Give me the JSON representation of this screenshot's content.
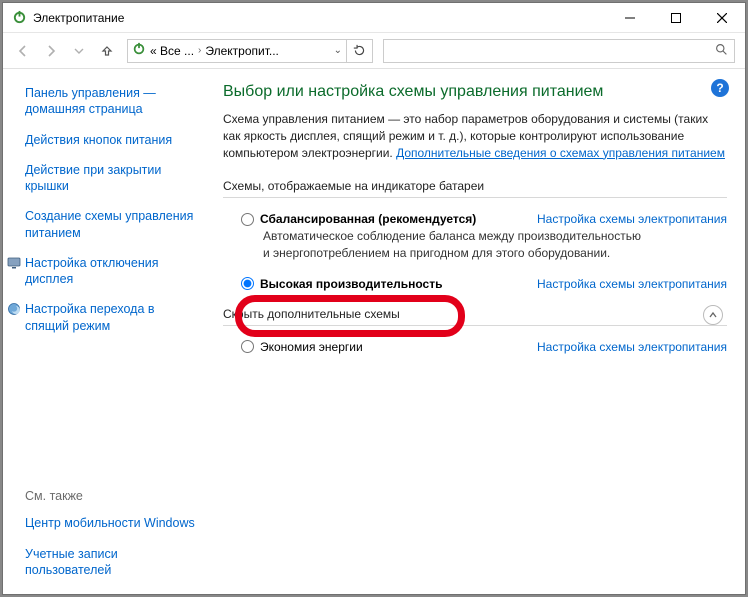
{
  "window": {
    "title": "Электропитание"
  },
  "address": {
    "crumb1": "« Все ...",
    "crumb2": "Электропит..."
  },
  "sidebar": {
    "home": "Панель управления — домашняя страница",
    "links": [
      "Действия кнопок питания",
      "Действие при закрытии крышки",
      "Создание схемы управления питанием"
    ],
    "iconLinks": [
      "Настройка отключения дисплея",
      "Настройка перехода в спящий режим"
    ],
    "seeAlsoHeader": "См. также",
    "seeAlso": [
      "Центр мобильности Windows",
      "Учетные записи пользователей"
    ]
  },
  "main": {
    "heading": "Выбор или настройка схемы управления питанием",
    "description": "Схема управления питанием — это набор параметров оборудования и системы (таких как яркость дисплея, спящий режим и т. д.), которые контролируют использование компьютером электроэнергии. ",
    "moreInfoLink": "Дополнительные сведения о схемах управления питанием",
    "section1": "Схемы, отображаемые на индикаторе батареи",
    "plan1": {
      "name": "Сбалансированная (рекомендуется)",
      "desc": "Автоматическое соблюдение баланса между производительностью и энергопотреблением на пригодном для этого оборудовании.",
      "configure": "Настройка схемы электропитания"
    },
    "plan2": {
      "name": "Высокая производительность",
      "configure": "Настройка схемы электропитания"
    },
    "section2": "Скрыть дополнительные схемы",
    "plan3": {
      "name": "Экономия энергии",
      "configure": "Настройка схемы электропитания"
    }
  }
}
